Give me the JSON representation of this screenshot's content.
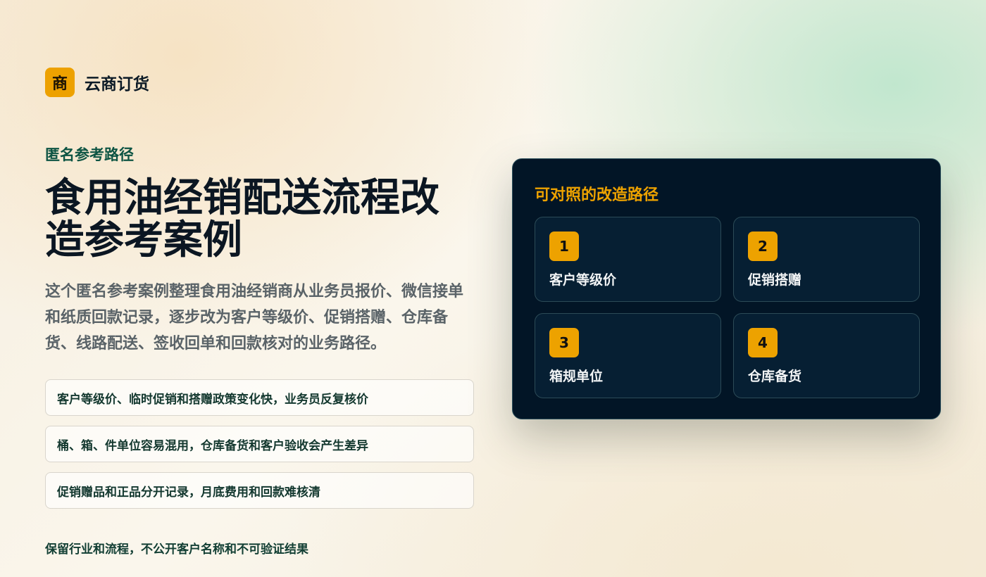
{
  "brand": {
    "logo_char": "商",
    "name": "云商订货"
  },
  "hero": {
    "eyebrow": "匿名参考路径",
    "title": "食用油经销配送流程改造参考案例",
    "description": "这个匿名参考案例整理食用油经销商从业务员报价、微信接单和纸质回款记录，逐步改为客户等级价、促销搭赠、仓库备货、线路配送、签收回单和回款核对的业务路径。"
  },
  "pain_points": [
    "客户等级价、临时促销和搭赠政策变化快，业务员反复核价",
    "桶、箱、件单位容易混用，仓库备货和客户验收会产生差异",
    "促销赠品和正品分开记录，月底费用和回款难核清"
  ],
  "footnote": "保留行业和流程，不公开客户名称和不可验证结果",
  "path_card": {
    "title": "可对照的改造路径",
    "steps": [
      {
        "num": "1",
        "label": "客户等级价"
      },
      {
        "num": "2",
        "label": "促销搭赠"
      },
      {
        "num": "3",
        "label": "箱规单位"
      },
      {
        "num": "4",
        "label": "仓库备货"
      }
    ]
  },
  "colors": {
    "accent": "#eda200",
    "card_bg": "#021526",
    "heading": "#0b1622",
    "eyebrow": "#0d5443"
  }
}
